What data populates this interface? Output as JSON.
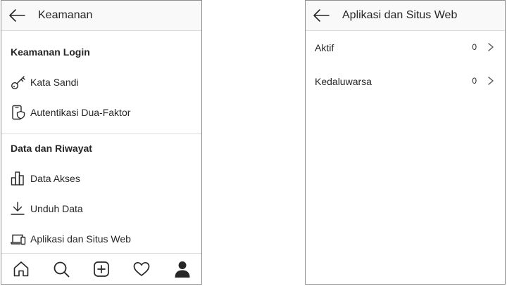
{
  "left": {
    "header": {
      "title": "Keamanan",
      "back_icon": "arrow-left-icon"
    },
    "sections": [
      {
        "title": "Keamanan Login",
        "items": [
          {
            "label": "Kata Sandi",
            "icon": "key-icon"
          },
          {
            "label": "Autentikasi Dua-Faktor",
            "icon": "phone-shield-icon"
          }
        ]
      },
      {
        "title": "Data dan Riwayat",
        "items": [
          {
            "label": "Data Akses",
            "icon": "bar-chart-icon"
          },
          {
            "label": "Unduh Data",
            "icon": "download-icon"
          },
          {
            "label": "Aplikasi dan Situs Web",
            "icon": "devices-icon"
          }
        ]
      }
    ],
    "bottom_nav": [
      {
        "icon": "home-icon"
      },
      {
        "icon": "search-icon"
      },
      {
        "icon": "add-post-icon"
      },
      {
        "icon": "heart-icon"
      },
      {
        "icon": "profile-icon",
        "active": true
      }
    ]
  },
  "right": {
    "header": {
      "title": "Aplikasi dan Situs Web",
      "back_icon": "arrow-left-icon"
    },
    "rows": [
      {
        "label": "Aktif",
        "count": "0",
        "icon": "chevron-right-icon"
      },
      {
        "label": "Kedaluwarsa",
        "count": "0",
        "icon": "chevron-right-icon"
      }
    ]
  },
  "colors": {
    "text": "#262626",
    "border": "#dbdbdb",
    "header_bg": "#f9f9f9",
    "frame": "#8e8e8e",
    "icon": "#262626"
  }
}
